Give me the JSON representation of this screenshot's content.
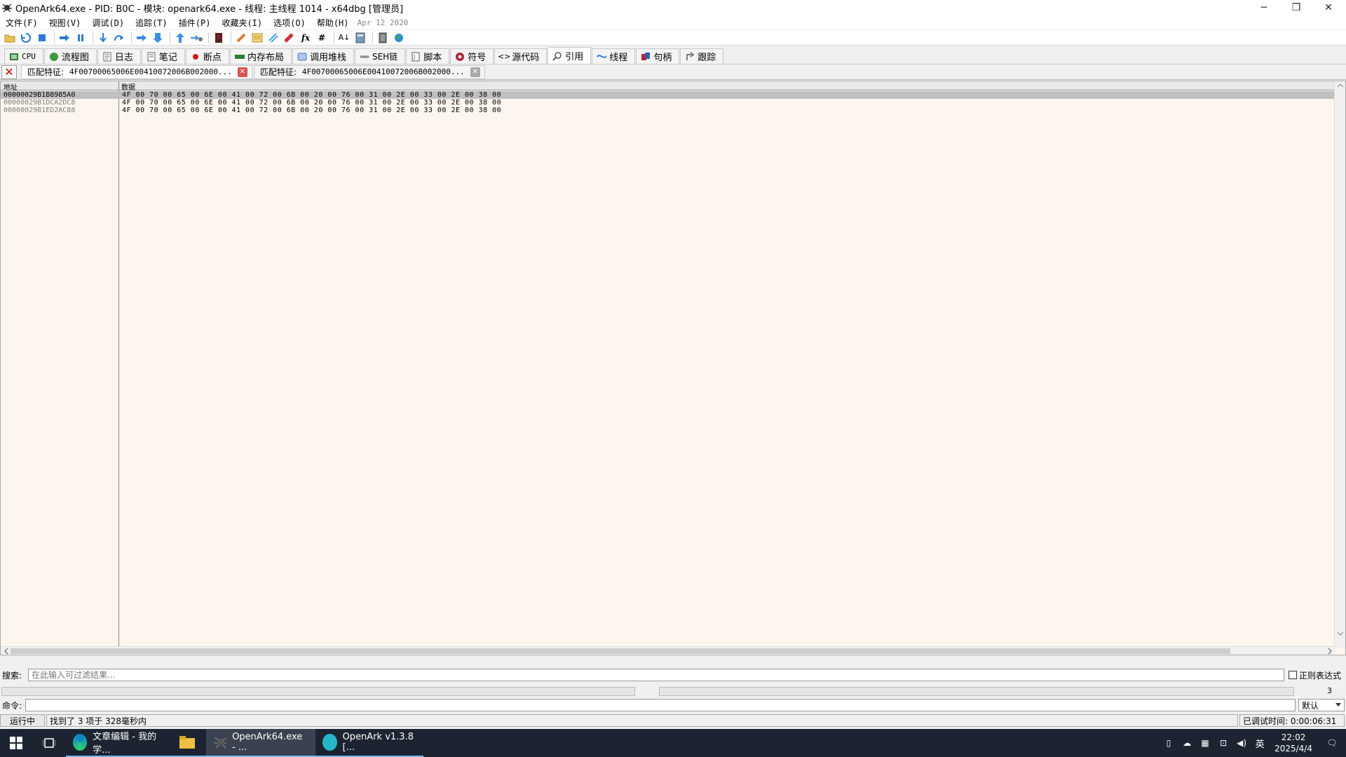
{
  "window": {
    "title": "OpenArk64.exe - PID: B0C - 模块: openark64.exe - 线程: 主线程 1014 - x64dbg [管理员]",
    "buttons": {
      "minimize": "─",
      "restore": "❐",
      "close": "✕"
    }
  },
  "menu": {
    "items": [
      "文件(F)",
      "视图(V)",
      "调试(D)",
      "追踪(T)",
      "插件(P)",
      "收藏夹(I)",
      "选项(O)",
      "帮助(H)"
    ],
    "date": "Apr 12 2020"
  },
  "toolbar": {
    "icons": [
      "open-icon",
      "restart-icon",
      "stop-icon",
      "run-icon",
      "pause-icon",
      "step-into-icon",
      "step-over-icon",
      "trace-into-icon",
      "trace-over-icon",
      "execute-till-return-icon",
      "run-to-user-code-icon",
      "scylla-icon",
      "patch-icon",
      "comment-icon",
      "label-icon",
      "bookmark-icon",
      "function-icon",
      "hash-icon",
      "font-icon",
      "calculator-icon",
      "notes-icon",
      "globe-icon"
    ],
    "fx_label": "fx",
    "hash_label": "#",
    "font_label": "A↓"
  },
  "tabs": [
    {
      "label": "CPU",
      "icon": "cpu-icon"
    },
    {
      "label": "流程图",
      "icon": "graph-icon"
    },
    {
      "label": "日志",
      "icon": "log-icon"
    },
    {
      "label": "笔记",
      "icon": "notes-icon"
    },
    {
      "label": "断点",
      "icon": "breakpoint-icon"
    },
    {
      "label": "内存布局",
      "icon": "memory-icon"
    },
    {
      "label": "调用堆栈",
      "icon": "callstack-icon"
    },
    {
      "label": "SEH链",
      "icon": "seh-icon"
    },
    {
      "label": "脚本",
      "icon": "script-icon"
    },
    {
      "label": "符号",
      "icon": "symbol-icon"
    },
    {
      "label": "源代码",
      "icon": "source-icon"
    },
    {
      "label": "引用",
      "icon": "references-icon",
      "active": true
    },
    {
      "label": "线程",
      "icon": "threads-icon"
    },
    {
      "label": "句柄",
      "icon": "handles-icon"
    },
    {
      "label": "跟踪",
      "icon": "trace-icon"
    }
  ],
  "reftabs": [
    {
      "label": "匹配特征:",
      "value": "4F00700065006E00410072006B002000...",
      "active": true
    },
    {
      "label": "匹配特征:",
      "value": "4F00700065006E00410072006B002000...",
      "active": false
    }
  ],
  "table": {
    "headers": [
      "地址",
      "数据"
    ],
    "rows": [
      {
        "addr": "00000029B1B8985A0",
        "data": "4F 00 70 00 65 00 6E 00 41 00 72 00 6B 00 20 00 76 00 31 00 2E 00 33 00 2E 00 38 00",
        "selected": true
      },
      {
        "addr": "00000029B1DCA2DC8",
        "data": "4F 00 70 00 65 00 6E 00 41 00 72 00 6B 00 20 00 76 00 31 00 2E 00 33 00 2E 00 38 00",
        "selected": false
      },
      {
        "addr": "00000029B1ED2AC88",
        "data": "4F 00 70 00 65 00 6E 00 41 00 72 00 6B 00 20 00 76 00 31 00 2E 00 33 00 2E 00 38 00",
        "selected": false
      }
    ]
  },
  "search": {
    "label": "搜索:",
    "placeholder": "在此输入可过滤结果...",
    "regex_label": "正则表达式",
    "count": "3"
  },
  "command": {
    "label": "命令:",
    "value": "",
    "mode": "默认"
  },
  "status": {
    "state": "运行中",
    "message": "找到了 3 项于 328毫秒内",
    "debug_time": "已调试时间: 0:00:06:31"
  },
  "taskbar": {
    "apps": [
      {
        "label": "文章编辑 - 我的学...",
        "icon": "edge-icon",
        "state": "open"
      },
      {
        "label": "",
        "icon": "explorer-icon",
        "state": "open"
      },
      {
        "label": "OpenArk64.exe - ...",
        "icon": "x64dbg-icon",
        "state": "active"
      },
      {
        "label": "OpenArk v1.3.8 [...",
        "icon": "openark-icon",
        "state": "open"
      }
    ],
    "tray": {
      "ime": "英",
      "time": "22:02",
      "date": "2025/4/4"
    }
  }
}
